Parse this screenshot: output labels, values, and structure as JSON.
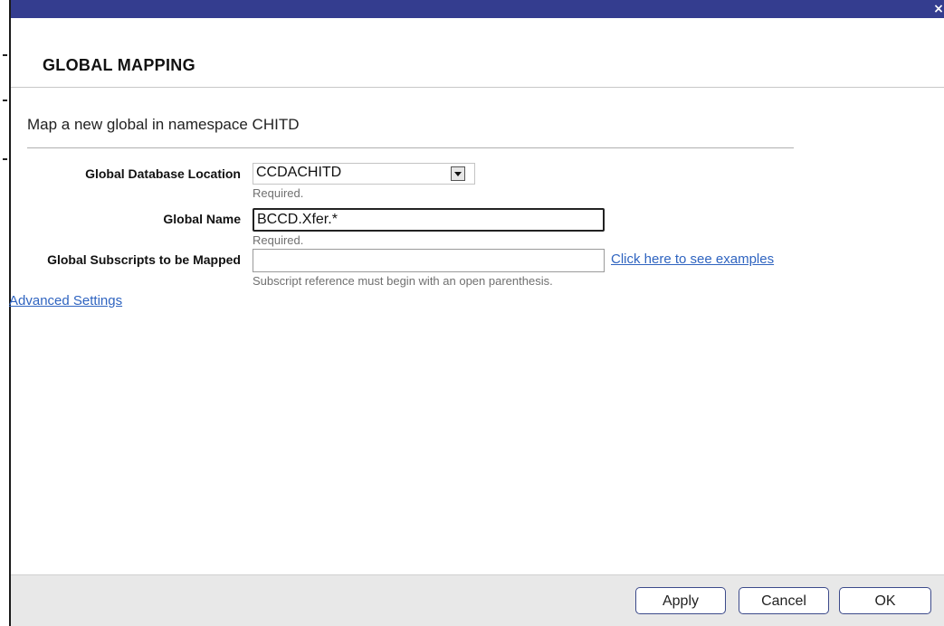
{
  "window": {
    "close_glyph": "×",
    "close_icon": "close-icon"
  },
  "header": {
    "title": "GLOBAL MAPPING"
  },
  "form": {
    "subtitle": "Map a new global in namespace CHITD",
    "database_location": {
      "label": "Global Database Location",
      "selected": "CCDACHITD",
      "hint": "Required."
    },
    "global_name": {
      "label": "Global Name",
      "value": "BCCD.Xfer.*",
      "hint": "Required."
    },
    "subscripts": {
      "label": "Global Subscripts to be Mapped",
      "value": "",
      "link": "Click here to see examples",
      "hint": "Subscript reference must begin with an open parenthesis."
    },
    "advanced_link": "Advanced Settings"
  },
  "footer": {
    "apply": "Apply",
    "cancel": "Cancel",
    "ok": "OK"
  },
  "colors": {
    "titlebar": "#343d8f",
    "link": "#2f64c0",
    "button_border": "#3c4a8a"
  }
}
